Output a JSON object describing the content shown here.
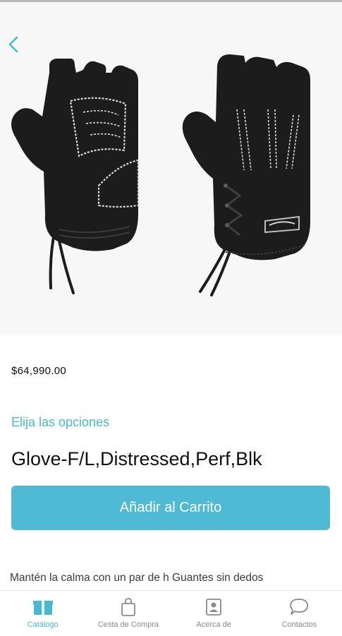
{
  "product": {
    "price": "$64,990.00",
    "options_label": "Elija las opciones",
    "title": "Glove-F/L,Distressed,Perf,Blk",
    "add_to_cart": "Añadir al Carrito",
    "description": "Mantén la calma con un par de h Guantes sin dedos"
  },
  "nav": {
    "items": [
      {
        "label": "Catálogo",
        "icon": "catalog-icon",
        "active": true
      },
      {
        "label": "Cesta de Compra",
        "icon": "shopping-bag-icon",
        "active": false
      },
      {
        "label": "Acerca de",
        "icon": "contact-card-icon",
        "active": false
      },
      {
        "label": "Contactos",
        "icon": "chat-bubble-icon",
        "active": false
      }
    ]
  },
  "colors": {
    "accent": "#4fbad3",
    "hero_background": "#f7f7f7",
    "glove": "#1c1c1c",
    "stitching": "#d9d9d9"
  }
}
